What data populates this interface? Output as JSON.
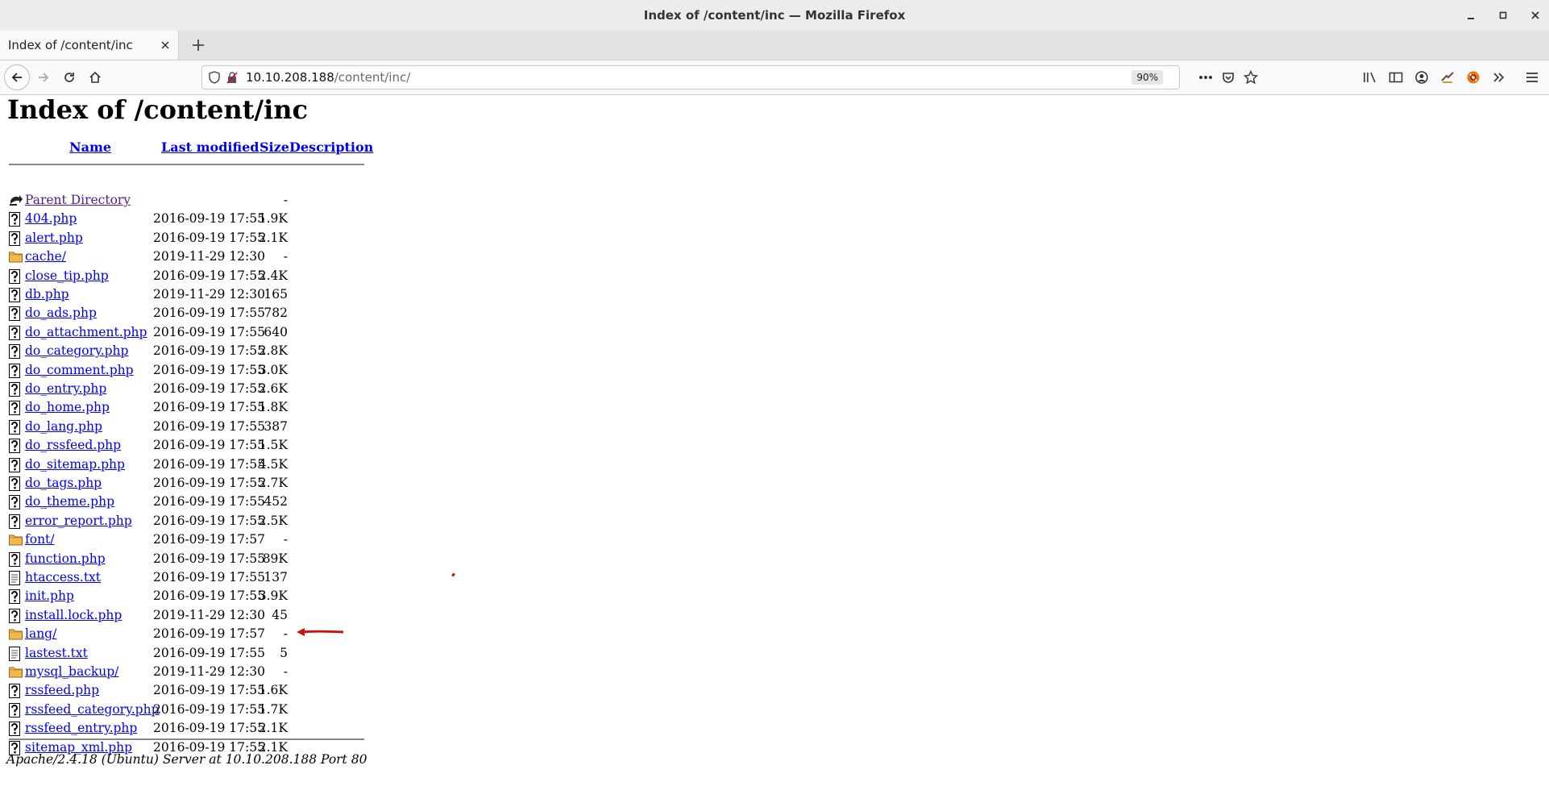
{
  "window": {
    "title": "Index of /content/inc — Mozilla Firefox"
  },
  "tab": {
    "title": "Index of /content/inc"
  },
  "address": {
    "host": "10.10.208.188",
    "path": "/content/inc/",
    "zoom": "90%"
  },
  "page": {
    "heading": "Index of /content/inc",
    "columns": {
      "name": "Name",
      "last_modified": "Last modified",
      "size": "Size",
      "description": "Description"
    },
    "rows": [
      {
        "icon": "parent",
        "name": "Parent Directory",
        "date": "",
        "size": "-"
      },
      {
        "icon": "unknown",
        "name": "404.php",
        "date": "2016-09-19 17:55",
        "size": "1.9K"
      },
      {
        "icon": "unknown",
        "name": "alert.php",
        "date": "2016-09-19 17:55",
        "size": "2.1K"
      },
      {
        "icon": "folder",
        "name": "cache/",
        "date": "2019-11-29 12:30",
        "size": "-"
      },
      {
        "icon": "unknown",
        "name": "close_tip.php",
        "date": "2016-09-19 17:55",
        "size": "2.4K"
      },
      {
        "icon": "unknown",
        "name": "db.php",
        "date": "2019-11-29 12:30",
        "size": "165"
      },
      {
        "icon": "unknown",
        "name": "do_ads.php",
        "date": "2016-09-19 17:55",
        "size": "782"
      },
      {
        "icon": "unknown",
        "name": "do_attachment.php",
        "date": "2016-09-19 17:55",
        "size": "640"
      },
      {
        "icon": "unknown",
        "name": "do_category.php",
        "date": "2016-09-19 17:55",
        "size": "2.8K"
      },
      {
        "icon": "unknown",
        "name": "do_comment.php",
        "date": "2016-09-19 17:55",
        "size": "3.0K"
      },
      {
        "icon": "unknown",
        "name": "do_entry.php",
        "date": "2016-09-19 17:55",
        "size": "2.6K"
      },
      {
        "icon": "unknown",
        "name": "do_home.php",
        "date": "2016-09-19 17:55",
        "size": "1.8K"
      },
      {
        "icon": "unknown",
        "name": "do_lang.php",
        "date": "2016-09-19 17:55",
        "size": "387"
      },
      {
        "icon": "unknown",
        "name": "do_rssfeed.php",
        "date": "2016-09-19 17:55",
        "size": "1.5K"
      },
      {
        "icon": "unknown",
        "name": "do_sitemap.php",
        "date": "2016-09-19 17:55",
        "size": "4.5K"
      },
      {
        "icon": "unknown",
        "name": "do_tags.php",
        "date": "2016-09-19 17:55",
        "size": "2.7K"
      },
      {
        "icon": "unknown",
        "name": "do_theme.php",
        "date": "2016-09-19 17:55",
        "size": "452"
      },
      {
        "icon": "unknown",
        "name": "error_report.php",
        "date": "2016-09-19 17:55",
        "size": "2.5K"
      },
      {
        "icon": "folder",
        "name": "font/",
        "date": "2016-09-19 17:57",
        "size": "-"
      },
      {
        "icon": "unknown",
        "name": "function.php",
        "date": "2016-09-19 17:55",
        "size": "89K"
      },
      {
        "icon": "text",
        "name": "htaccess.txt",
        "date": "2016-09-19 17:55",
        "size": "137"
      },
      {
        "icon": "unknown",
        "name": "init.php",
        "date": "2016-09-19 17:55",
        "size": "3.9K"
      },
      {
        "icon": "unknown",
        "name": "install.lock.php",
        "date": "2019-11-29 12:30",
        "size": "45"
      },
      {
        "icon": "folder",
        "name": "lang/",
        "date": "2016-09-19 17:57",
        "size": "-"
      },
      {
        "icon": "text",
        "name": "lastest.txt",
        "date": "2016-09-19 17:55",
        "size": "5"
      },
      {
        "icon": "folder",
        "name": "mysql_backup/",
        "date": "2019-11-29 12:30",
        "size": "-"
      },
      {
        "icon": "unknown",
        "name": "rssfeed.php",
        "date": "2016-09-19 17:55",
        "size": "1.6K"
      },
      {
        "icon": "unknown",
        "name": "rssfeed_category.php",
        "date": "2016-09-19 17:55",
        "size": "1.7K"
      },
      {
        "icon": "unknown",
        "name": "rssfeed_entry.php",
        "date": "2016-09-19 17:55",
        "size": "2.1K"
      },
      {
        "icon": "unknown",
        "name": "sitemap_xml.php",
        "date": "2016-09-19 17:55",
        "size": "2.1K"
      }
    ],
    "footer": "Apache/2.4.18 (Ubuntu) Server at 10.10.208.188 Port 80"
  },
  "annotation": {
    "color": "#cc1111"
  },
  "colors": {
    "link": "#0000ee",
    "visited": "#551a8b"
  }
}
